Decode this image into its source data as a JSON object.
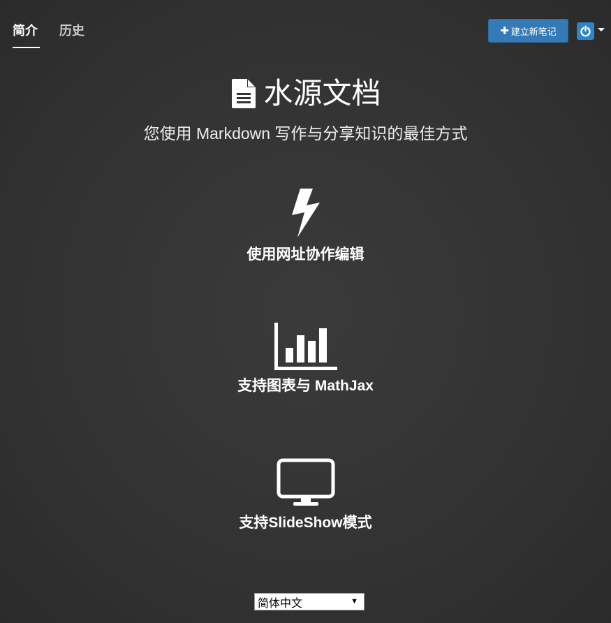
{
  "nav": {
    "tabs": [
      {
        "label": "简介",
        "active": true
      },
      {
        "label": "历史",
        "active": false
      }
    ],
    "new_note_label": "建立新笔记",
    "accent_color": "#337ab7"
  },
  "hero": {
    "icon": "file-text-icon",
    "title": "水源文档",
    "subtitle": "您使用 Markdown 写作与分享知识的最佳方式"
  },
  "features": [
    {
      "icon": "bolt-icon",
      "label": "使用网址协作编辑"
    },
    {
      "icon": "bar-chart-icon",
      "label": "支持图表与 MathJax"
    },
    {
      "icon": "desktop-icon",
      "label": "支持SlideShow模式"
    }
  ],
  "language_select": {
    "selected": "简体中文"
  }
}
